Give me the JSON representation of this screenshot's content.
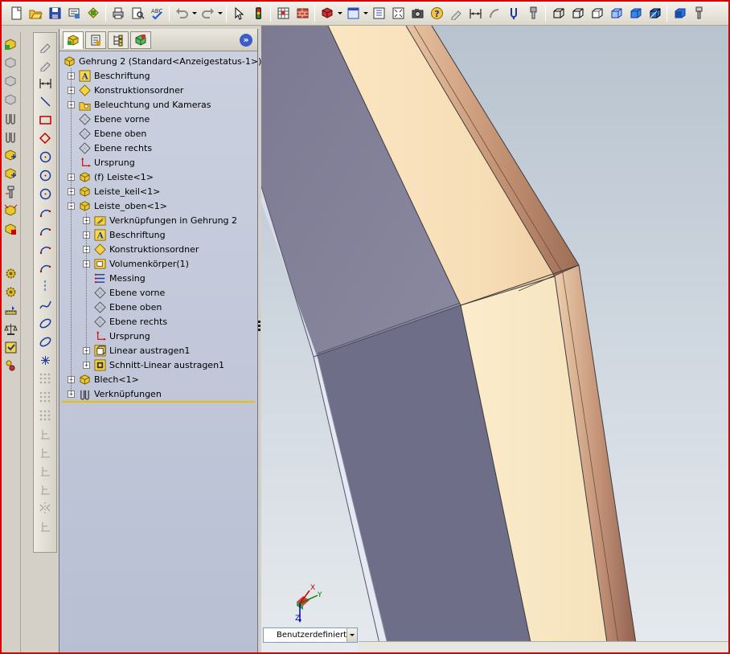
{
  "toolbar": {
    "icons": [
      "new-icon",
      "open-icon",
      "save-icon",
      "print-preview-icon",
      "options-icon",
      "print-icon",
      "preview-icon",
      "spelling-icon",
      "undo-icon",
      "redo-icon",
      "select-icon",
      "rebuild-icon",
      "grid-icon",
      "brick-icon",
      "appearance-icon",
      "view-orientation-icon",
      "list-icon",
      "zoom-fit-icon",
      "camera-icon",
      "help-icon",
      "sketch-icon",
      "dimension-icon",
      "arc-icon",
      "vertical-icon",
      "hole-icon",
      "box-view-1-icon",
      "box-view-2-icon",
      "box-view-3-icon",
      "box-view-4-icon",
      "box-view-5-icon",
      "box-view-6-icon",
      "display-icon",
      "screw-icon"
    ]
  },
  "feature_manager": {
    "tabs": [
      "feature-tree",
      "property-manager",
      "configuration-manager",
      "dimxpert-manager"
    ],
    "tree": {
      "root": "Gehrung 2  (Standard<Anzeigestatus-1>)",
      "items": [
        {
          "label": "Beschriftung",
          "icon": "annotation-icon",
          "expander": "+"
        },
        {
          "label": "Konstruktionsordner",
          "icon": "design-binder-icon",
          "expander": "+"
        },
        {
          "label": "Beleuchtung und Kameras",
          "icon": "lights-cameras-icon",
          "expander": "+"
        },
        {
          "label": "Ebene vorne",
          "icon": "plane-icon",
          "expander": ""
        },
        {
          "label": "Ebene oben",
          "icon": "plane-icon",
          "expander": ""
        },
        {
          "label": "Ebene rechts",
          "icon": "plane-icon",
          "expander": ""
        },
        {
          "label": "Ursprung",
          "icon": "origin-icon",
          "expander": ""
        },
        {
          "label": "(f) Leiste<1>",
          "icon": "part-icon",
          "expander": "+"
        },
        {
          "label": "Leiste_keil<1>",
          "icon": "part-icon",
          "expander": "+"
        },
        {
          "label": "Leiste_oben<1>",
          "icon": "part-icon",
          "expander": "-"
        }
      ],
      "sub_items": [
        {
          "label": "Verknüpfungen in Gehrung 2",
          "icon": "mates-in-assembly-icon",
          "expander": "+"
        },
        {
          "label": "Beschriftung",
          "icon": "annotation-icon",
          "expander": "+"
        },
        {
          "label": "Konstruktionsordner",
          "icon": "design-binder-icon",
          "expander": "+"
        },
        {
          "label": "Volumenkörper(1)",
          "icon": "solid-bodies-icon",
          "expander": "+"
        },
        {
          "label": "Messing",
          "icon": "material-icon",
          "expander": ""
        },
        {
          "label": "Ebene vorne",
          "icon": "plane-icon",
          "expander": ""
        },
        {
          "label": "Ebene oben",
          "icon": "plane-icon",
          "expander": ""
        },
        {
          "label": "Ebene rechts",
          "icon": "plane-icon",
          "expander": ""
        },
        {
          "label": "Ursprung",
          "icon": "origin-icon",
          "expander": ""
        },
        {
          "label": "Linear austragen1",
          "icon": "extrude-icon",
          "expander": "+"
        },
        {
          "label": "Schnitt-Linear austragen1",
          "icon": "cut-extrude-icon",
          "expander": "+"
        }
      ],
      "tail_items": [
        {
          "label": "Blech<1>",
          "icon": "part-icon",
          "expander": "+"
        },
        {
          "label": "Verknüpfungen",
          "icon": "mates-icon",
          "expander": "+"
        }
      ]
    }
  },
  "viewport": {
    "triad": {
      "x_label": "X",
      "y_label": "Y",
      "z_label": "Z"
    },
    "view_select": {
      "value": "Benutzerdefiniert"
    }
  },
  "colors": {
    "red_accent": "#d40000",
    "panel_blue": "#c3c9da",
    "wood_face": "#f7e4c0",
    "wood_edge": "#b8876f",
    "steel_face": "#70708a"
  }
}
